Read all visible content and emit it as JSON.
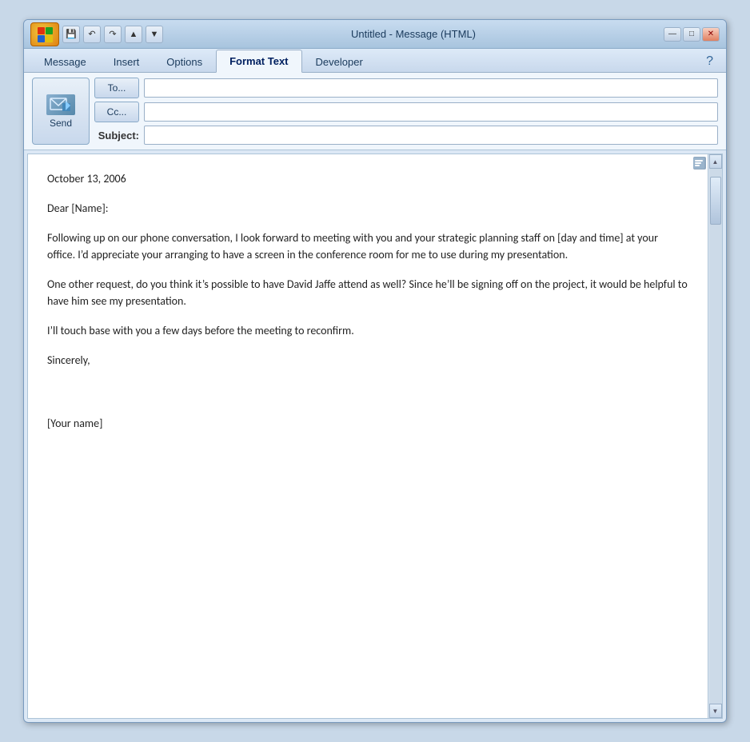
{
  "titlebar": {
    "title": "Untitled - Message (HTML)",
    "qat_buttons": [
      "save",
      "undo",
      "redo",
      "up",
      "down"
    ],
    "controls": [
      "minimize",
      "maximize",
      "close"
    ]
  },
  "ribbon": {
    "tabs": [
      {
        "id": "message",
        "label": "Message",
        "active": false
      },
      {
        "id": "insert",
        "label": "Insert",
        "active": false
      },
      {
        "id": "options",
        "label": "Options",
        "active": false
      },
      {
        "id": "format-text",
        "label": "Format Text",
        "active": true
      },
      {
        "id": "developer",
        "label": "Developer",
        "active": false
      }
    ],
    "help_label": "?"
  },
  "compose": {
    "to_label": "To...",
    "cc_label": "Cc...",
    "subject_label": "Subject:",
    "to_value": "",
    "cc_value": "",
    "subject_value": "",
    "send_label": "Send"
  },
  "body": {
    "date": "October 13, 2006",
    "greeting": "Dear [Name]:",
    "paragraph1": "Following up on our phone conversation, I look forward to meeting with you and your strategic planning staff on [day and time] at your office. I’d appreciate your arranging to have a screen in the conference room for me to use during my presentation.",
    "paragraph2": "One other request, do you think it’s possible to have David Jaffe attend as well? Since he’ll be signing off on the project, it would be helpful to have him see my presentation.",
    "paragraph3": "I’ll touch base with you a few days before the meeting to reconfirm.",
    "closing": "Sincerely,",
    "signature": "[Your name]"
  },
  "icons": {
    "save": "💾",
    "undo": "↶",
    "redo": "↷",
    "up": "▲",
    "down": "▼",
    "minimize": "—",
    "maximize": "□",
    "close": "✕",
    "send": "✉",
    "scroll_up": "▲",
    "scroll_down": "▼"
  },
  "colors": {
    "accent": "#336699",
    "titlebar_bg": "#c8dcf0",
    "ribbon_bg": "#ddeaf8",
    "body_bg": "#ffffff"
  }
}
